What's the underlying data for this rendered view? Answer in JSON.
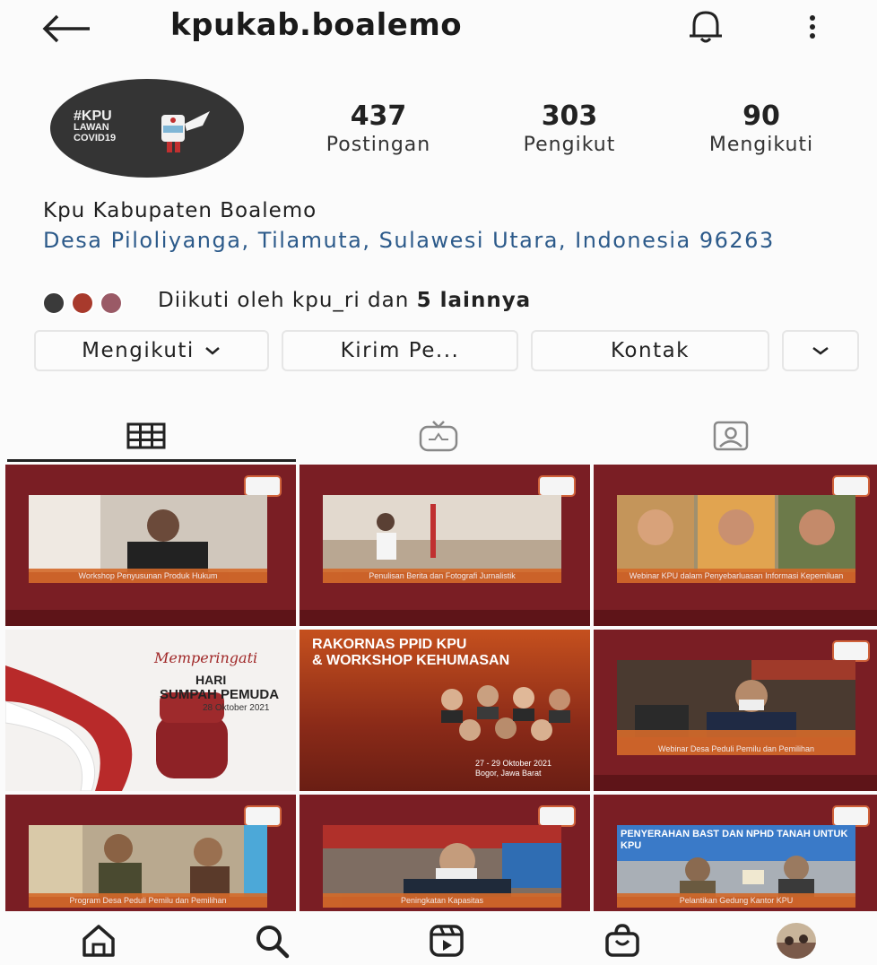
{
  "header": {
    "username": "kpukab.boalemo",
    "back_icon": "arrow-left-icon",
    "bell_icon": "bell-icon",
    "more_icon": "more-vertical-icon"
  },
  "profile": {
    "avatar_text": [
      "#KPU",
      "LAWAN",
      "COVID19"
    ],
    "stats": [
      {
        "value": "437",
        "label": "Postingan"
      },
      {
        "value": "303",
        "label": "Pengikut"
      },
      {
        "value": "90",
        "label": "Mengikuti"
      }
    ],
    "name": "Kpu Kabupaten Boalemo",
    "location": "Desa Piloliyanga, Tilamuta, Sulawesi Utara, Indonesia 96263",
    "followed_by_prefix": "Diikuti oleh kpu_ri dan",
    "followed_by_bold": "5 lainnya"
  },
  "actions": {
    "following": "Mengikuti",
    "message": "Kirim Pe...",
    "contact": "Kontak"
  },
  "tabs": [
    "grid-icon",
    "igtv-icon",
    "tagged-icon"
  ],
  "posts": [
    {
      "caption": "Workshop Penyusunan Produk Hukum",
      "bg": "#7b1f26",
      "photo": "#cfc6bd"
    },
    {
      "caption": "Penulisan Berita dan Fotografi Jurnalistik",
      "bg": "#7d2128",
      "photo": "#d8cfc4"
    },
    {
      "caption": "Webinar KPU dalam Penyebarluasan Informasi Kepemiluan",
      "bg": "#7a1f25",
      "photo": "#9e8c6c"
    },
    {
      "title1": "Memperingati",
      "title2": "HARI",
      "title3": "SUMPAH PEMUDA",
      "date": "28 Oktober 2021",
      "bg": "#f4f2f0"
    },
    {
      "title1": "RAKORNAS PPID KPU",
      "title2": "& WORKSHOP KEHUMASAN",
      "date": "27 - 29 Oktober 2021",
      "place": "Bogor, Jawa Barat",
      "bg": "#8e2b1a"
    },
    {
      "caption": "Webinar Desa Peduli Pemilu dan Pemilihan",
      "bg": "#7a1f26",
      "photo": "#4a3a30"
    },
    {
      "caption": "Program Desa Peduli Pemilu dan Pemilihan",
      "bg": "#7b1f25",
      "photo": "#b9a98f"
    },
    {
      "caption": "Peningkatan Kapasitas",
      "bg": "#7c2027",
      "photo": "#7e6d62"
    },
    {
      "caption": "Pelantikan Gedung Kantor KPU",
      "bg": "#7a1f25",
      "photo": "#a9afb6",
      "banner": "PENYERAHAN BAST DAN NPHD TANAH UNTUK KPU"
    }
  ],
  "bottom_nav": [
    "home-icon",
    "search-icon",
    "reels-icon",
    "shop-icon",
    "profile-avatar"
  ]
}
